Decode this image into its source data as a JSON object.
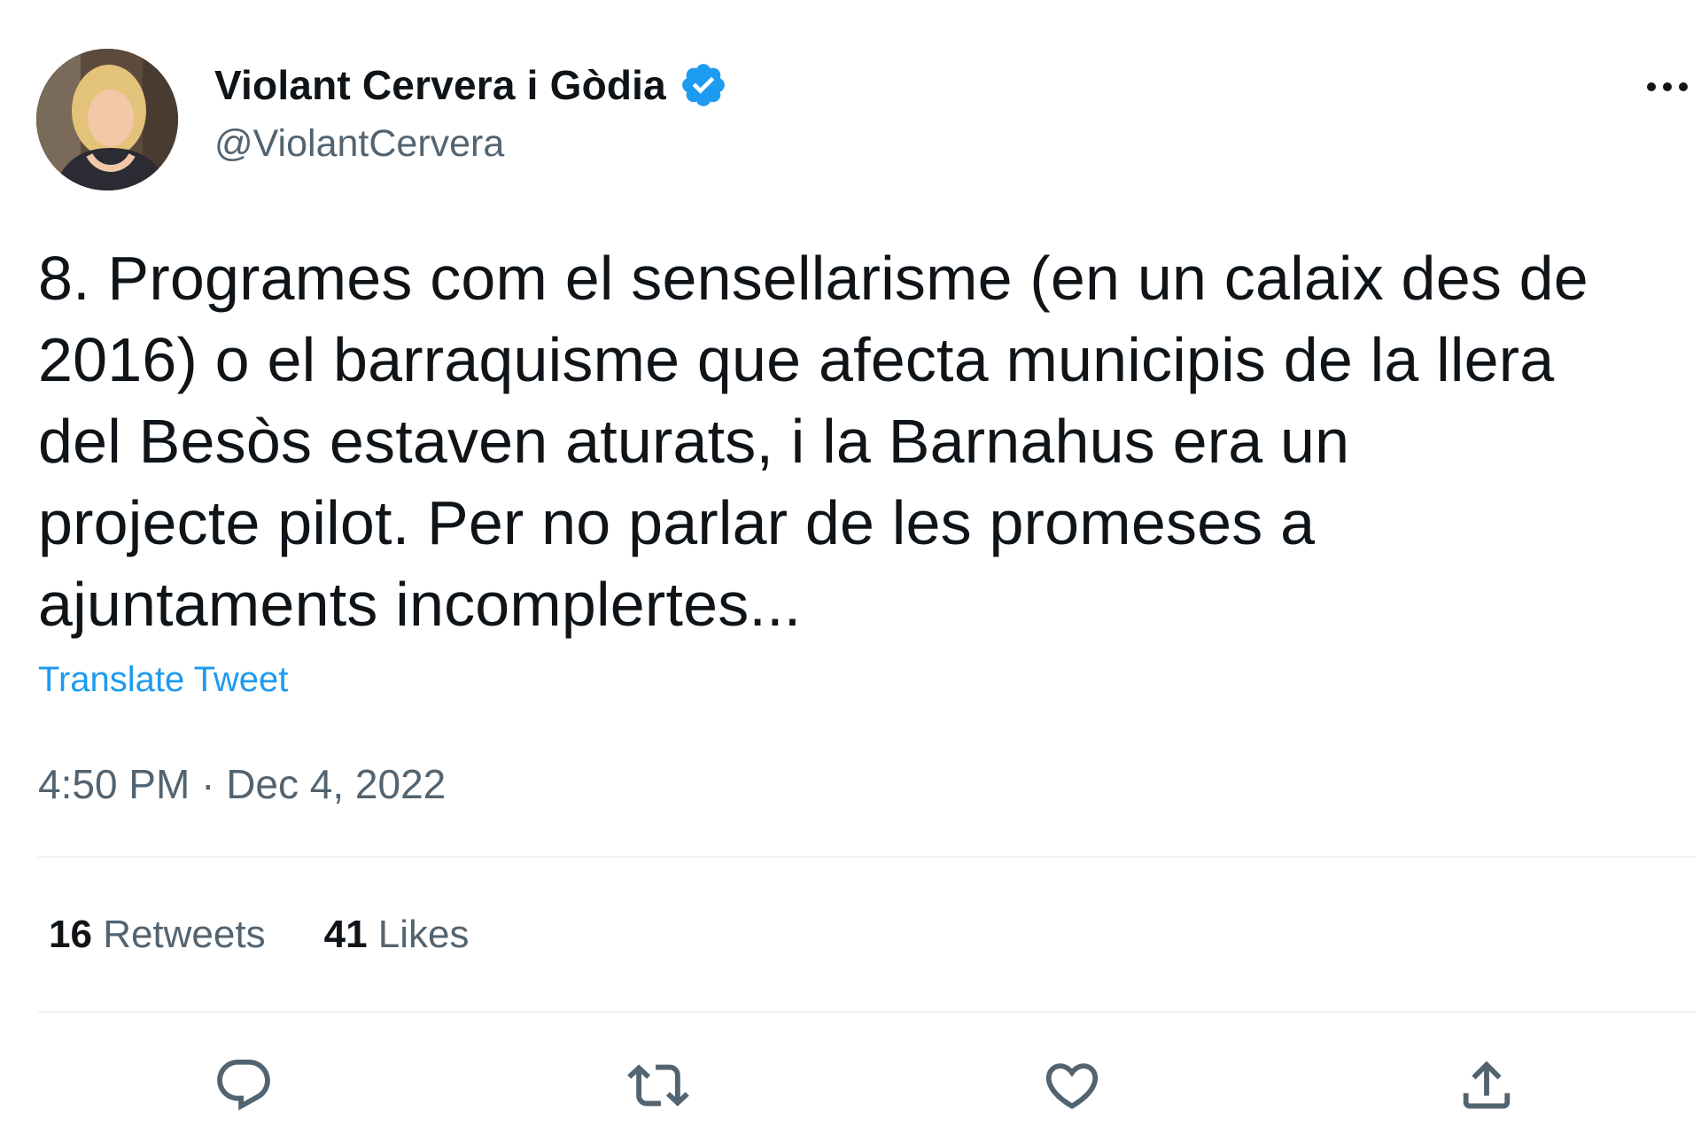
{
  "author": {
    "display_name": "Violant Cervera i Gòdia",
    "handle": "@ViolantCervera",
    "verified": true
  },
  "tweet": {
    "text": "8. Programes com el sensellarisme (en un calaix des de\n2016) o el barraquisme que afecta municipis de la llera\ndel Besòs estaven aturats, i la Barnahus era un\nprojecte pilot. Per no parlar de les promeses a\najuntaments incomplertes...",
    "translate_label": "Translate Tweet",
    "timestamp": "4:50 PM · Dec 4, 2022"
  },
  "stats": {
    "retweets_count": "16",
    "retweets_label": "Retweets",
    "likes_count": "41",
    "likes_label": "Likes"
  },
  "icons": {
    "more": "more-horizontal-icon",
    "verified": "verified-badge-icon",
    "reply": "reply-icon",
    "retweet": "retweet-icon",
    "like": "heart-icon",
    "share": "share-icon"
  },
  "colors": {
    "link": "#1d9bf0",
    "verified": "#1d9bf0",
    "secondary_text": "#536471",
    "primary_text": "#0f1419",
    "divider": "#eff3f4"
  }
}
